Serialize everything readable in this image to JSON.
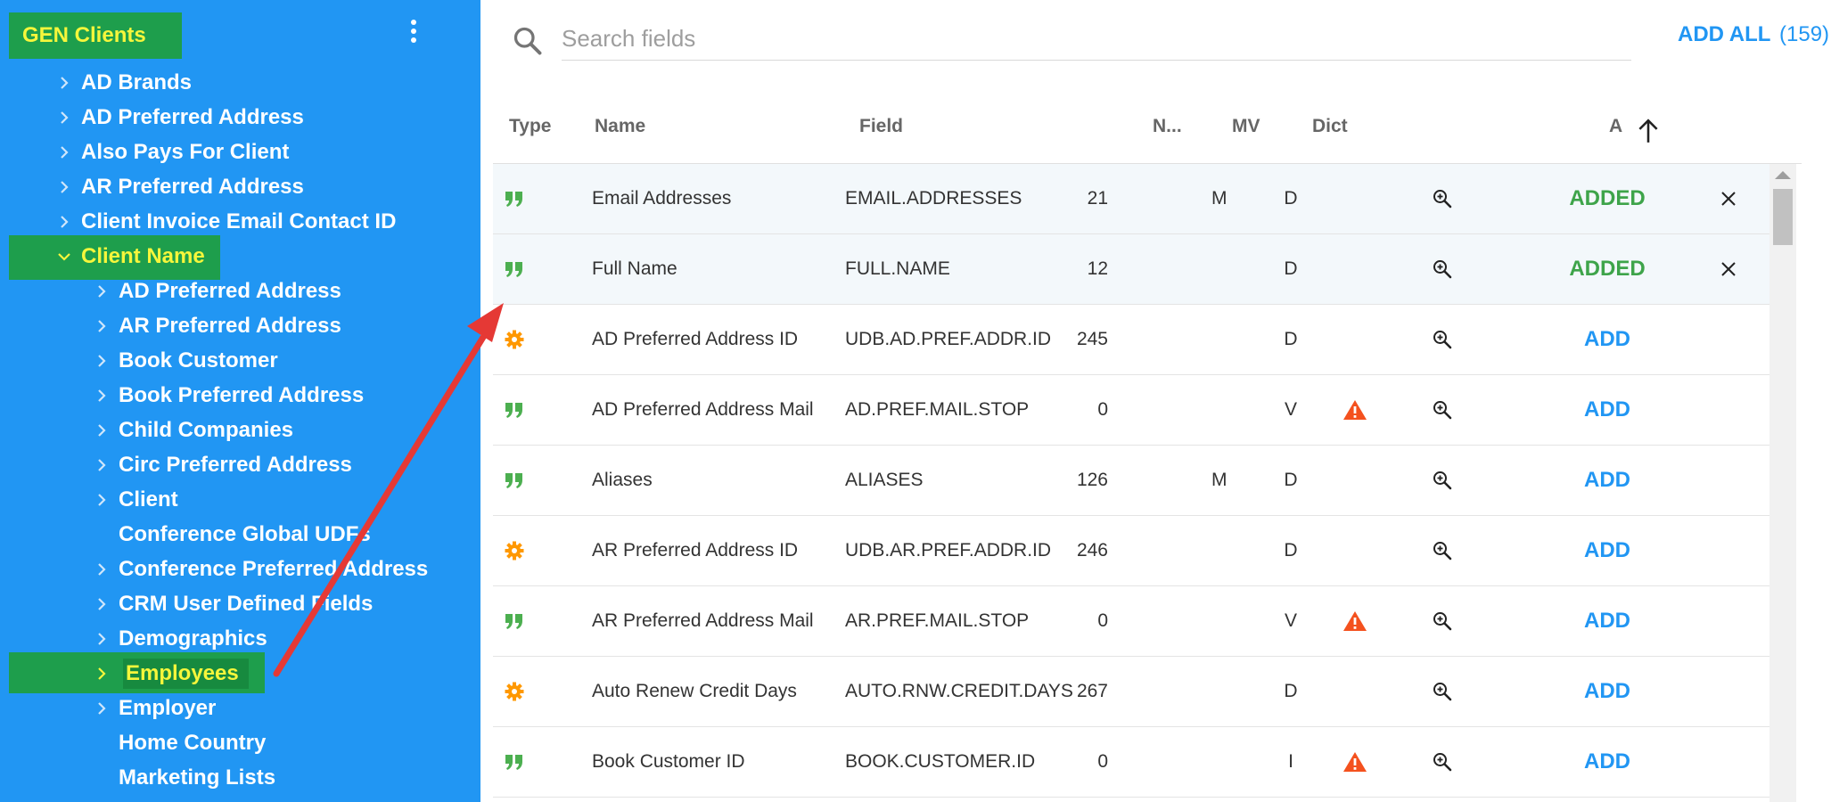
{
  "sidebar": {
    "root_label": "GEN Clients",
    "menu_icon": "more-vert-icon",
    "items": [
      {
        "label": "AD Brands",
        "level": 1,
        "expandable": true
      },
      {
        "label": "AD Preferred Address",
        "level": 1,
        "expandable": true
      },
      {
        "label": "Also Pays For Client",
        "level": 1,
        "expandable": true
      },
      {
        "label": "AR Preferred Address",
        "level": 1,
        "expandable": true
      },
      {
        "label": "Client Invoice Email Contact ID",
        "level": 1,
        "expandable": true
      },
      {
        "label": "Client Name",
        "level": 1,
        "expandable": true,
        "expanded": true,
        "highlighted": true
      },
      {
        "label": "AD Preferred Address",
        "level": 2,
        "expandable": true
      },
      {
        "label": "AR Preferred Address",
        "level": 2,
        "expandable": true
      },
      {
        "label": "Book Customer",
        "level": 2,
        "expandable": true
      },
      {
        "label": "Book Preferred Address",
        "level": 2,
        "expandable": true
      },
      {
        "label": "Child Companies",
        "level": 2,
        "expandable": true
      },
      {
        "label": "Circ Preferred Address",
        "level": 2,
        "expandable": true
      },
      {
        "label": "Client",
        "level": 2,
        "expandable": true
      },
      {
        "label": "Conference Global UDFs",
        "level": 2,
        "expandable": false
      },
      {
        "label": "Conference Preferred Address",
        "level": 2,
        "expandable": true
      },
      {
        "label": "CRM User Defined Fields",
        "level": 2,
        "expandable": true
      },
      {
        "label": "Demographics",
        "level": 2,
        "expandable": true
      },
      {
        "label": "Employees",
        "level": 2,
        "expandable": true,
        "highlighted": true
      },
      {
        "label": "Employer",
        "level": 2,
        "expandable": true
      },
      {
        "label": "Home Country",
        "level": 2,
        "expandable": false
      },
      {
        "label": "Marketing Lists",
        "level": 2,
        "expandable": false
      }
    ]
  },
  "search": {
    "placeholder": "Search fields",
    "value": "",
    "icon": "search-icon"
  },
  "add_all": {
    "label": "ADD ALL",
    "count": "(159)"
  },
  "table": {
    "headers": {
      "type": "Type",
      "name": "Name",
      "field": "Field",
      "n": "N...",
      "mv": "MV",
      "dict": "Dict",
      "a": "A"
    },
    "sort_icon": "arrow-up-icon",
    "rows": [
      {
        "type_icon": "quote-icon",
        "name": "Email Addresses",
        "field": "EMAIL.ADDRESSES",
        "n": "21",
        "mv": "M",
        "dict": "D",
        "warning": false,
        "action": "ADDED",
        "removable": true
      },
      {
        "type_icon": "quote-icon",
        "name": "Full Name",
        "field": "FULL.NAME",
        "n": "12",
        "mv": "",
        "dict": "D",
        "warning": false,
        "action": "ADDED",
        "removable": true
      },
      {
        "type_icon": "gear-icon",
        "name": "AD Preferred Address ID",
        "field": "UDB.AD.PREF.ADDR.ID",
        "n": "245",
        "mv": "",
        "dict": "D",
        "warning": false,
        "action": "ADD",
        "removable": false
      },
      {
        "type_icon": "quote-icon",
        "name": "AD Preferred Address Mail",
        "field": "AD.PREF.MAIL.STOP",
        "n": "0",
        "mv": "",
        "dict": "V",
        "warning": true,
        "action": "ADD",
        "removable": false
      },
      {
        "type_icon": "quote-icon",
        "name": "Aliases",
        "field": "ALIASES",
        "n": "126",
        "mv": "M",
        "dict": "D",
        "warning": false,
        "action": "ADD",
        "removable": false
      },
      {
        "type_icon": "gear-icon",
        "name": "AR Preferred Address ID",
        "field": "UDB.AR.PREF.ADDR.ID",
        "n": "246",
        "mv": "",
        "dict": "D",
        "warning": false,
        "action": "ADD",
        "removable": false
      },
      {
        "type_icon": "quote-icon",
        "name": "AR Preferred Address Mail",
        "field": "AR.PREF.MAIL.STOP",
        "n": "0",
        "mv": "",
        "dict": "V",
        "warning": true,
        "action": "ADD",
        "removable": false
      },
      {
        "type_icon": "gear-icon",
        "name": "Auto Renew Credit Days",
        "field": "AUTO.RNW.CREDIT.DAYS",
        "n": "267",
        "mv": "",
        "dict": "D",
        "warning": false,
        "action": "ADD",
        "removable": false
      },
      {
        "type_icon": "quote-icon",
        "name": "Book Customer ID",
        "field": "BOOK.CUSTOMER.ID",
        "n": "0",
        "mv": "",
        "dict": "I",
        "warning": true,
        "action": "ADD",
        "removable": false
      }
    ]
  },
  "colors": {
    "sidebar_bg": "#2196f3",
    "highlight_green": "#1e9e4c",
    "highlight_text": "#f6f63b",
    "accent_blue": "#2196f3",
    "added_green": "#3ea44a",
    "quote_green": "#4caf50",
    "gear_orange": "#ff9800",
    "warning_orange": "#f4511e",
    "annotation_red": "#e53935"
  }
}
